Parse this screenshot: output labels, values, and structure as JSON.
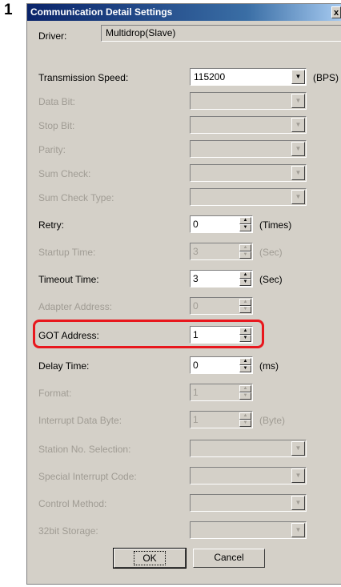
{
  "step_number": "1",
  "dialog": {
    "title": "Communication Detail Settings",
    "close_label": "x"
  },
  "driver": {
    "label": "Driver:",
    "value": "Multidrop(Slave)"
  },
  "fields": {
    "transmission_speed": {
      "label": "Transmission Speed:",
      "value": "115200",
      "unit": "(BPS)",
      "enabled": true
    },
    "data_bit": {
      "label": "Data Bit:",
      "value": "",
      "enabled": false
    },
    "stop_bit": {
      "label": "Stop Bit:",
      "value": "",
      "enabled": false
    },
    "parity": {
      "label": "Parity:",
      "value": "",
      "enabled": false
    },
    "sum_check": {
      "label": "Sum Check:",
      "value": "",
      "enabled": false
    },
    "sum_check_type": {
      "label": "Sum Check Type:",
      "value": "",
      "enabled": false
    },
    "retry": {
      "label": "Retry:",
      "value": "0",
      "unit": "(Times)",
      "enabled": true
    },
    "startup_time": {
      "label": "Startup Time:",
      "value": "3",
      "unit": "(Sec)",
      "enabled": false
    },
    "timeout_time": {
      "label": "Timeout Time:",
      "value": "3",
      "unit": "(Sec)",
      "enabled": true
    },
    "adapter_address": {
      "label": "Adapter Address:",
      "value": "0",
      "enabled": false
    },
    "got_address": {
      "label": "GOT Address:",
      "value": "1",
      "enabled": true
    },
    "delay_time": {
      "label": "Delay Time:",
      "value": "0",
      "unit": "(ms)",
      "enabled": true
    },
    "format": {
      "label": "Format:",
      "value": "1",
      "enabled": false
    },
    "interrupt_data_byte": {
      "label": "Interrupt Data Byte:",
      "value": "1",
      "unit": "(Byte)",
      "enabled": false
    },
    "station_no_selection": {
      "label": "Station No. Selection:",
      "value": "",
      "enabled": false
    },
    "special_interrupt_code": {
      "label": "Special Interrupt Code:",
      "value": "",
      "enabled": false
    },
    "control_method": {
      "label": "Control Method:",
      "value": "",
      "enabled": false
    },
    "storage_32bit": {
      "label": "32bit Storage:",
      "value": "",
      "enabled": false
    }
  },
  "buttons": {
    "ok": "OK",
    "cancel": "Cancel"
  },
  "colors": {
    "highlight": "#e8171d",
    "dialog_bg": "#d4d0c8",
    "title_bar": "#0a246a",
    "disabled_text": "#a09c94"
  },
  "icons": {
    "spin_up": "▲",
    "spin_down": "▼",
    "dropdown": "▼"
  }
}
